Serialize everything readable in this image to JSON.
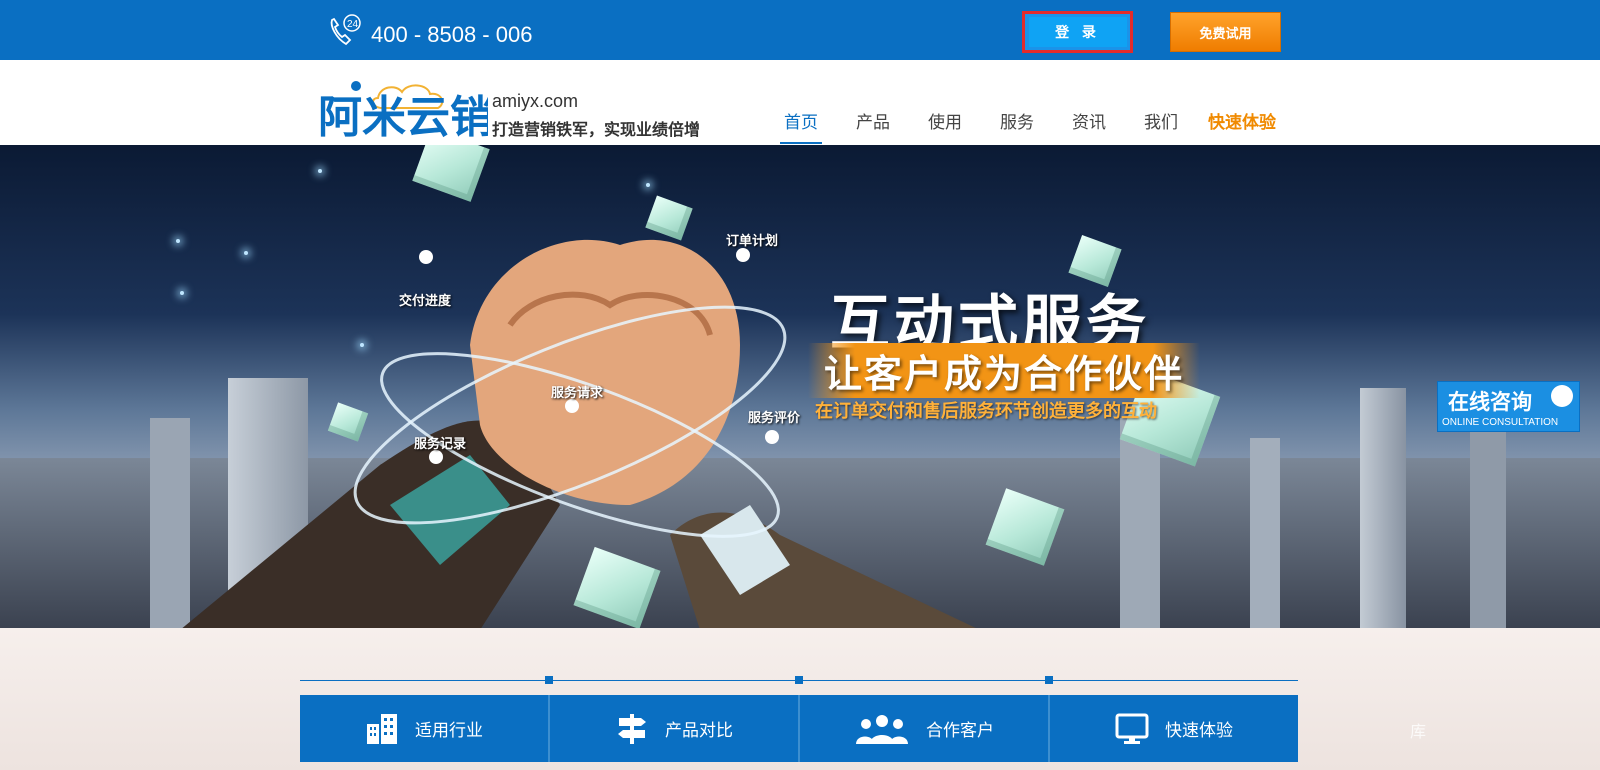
{
  "topbar": {
    "phone_icon": "phone-24h-icon",
    "phone": "400 - 8508 - 006",
    "login_label": "登 录",
    "trial_label": "免费试用"
  },
  "header": {
    "logo_text": "阿米云销",
    "domain": "amiyx.com",
    "slogan": "打造营销铁军，实现业绩倍增",
    "nav": [
      {
        "label": "首页"
      },
      {
        "label": "产品"
      },
      {
        "label": "使用"
      },
      {
        "label": "服务"
      },
      {
        "label": "资讯"
      },
      {
        "label": "我们"
      },
      {
        "label": "快速体验"
      }
    ],
    "colors": {
      "brand": "#0a6fc2",
      "accent": "#f08a00"
    }
  },
  "banner": {
    "headline": "互动式服务",
    "subline": "让客户成为合作伙伴",
    "tagline": "在订单交付和售后服务环节创造更多的互动",
    "orbit_labels": [
      "订单计划",
      "交付进度",
      "服务请求",
      "服务记录",
      "服务评价"
    ]
  },
  "consult": {
    "zh": "在线咨询",
    "en": "ONLINE CONSULTATION"
  },
  "features": [
    {
      "label": "适用行业",
      "icon": "building-icon"
    },
    {
      "label": "产品对比",
      "icon": "signpost-icon"
    },
    {
      "label": "合作客户",
      "icon": "users-icon"
    },
    {
      "label": "快速体验",
      "icon": "monitor-icon"
    }
  ],
  "ghost_text": "库"
}
